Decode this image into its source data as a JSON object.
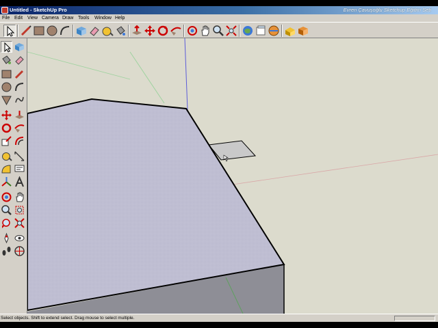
{
  "window": {
    "title": "Untitled - SketchUp Pro",
    "overlay_text": "Evren Çavuşoğlu Sketchup Eğitim Seti"
  },
  "menu": {
    "items": [
      "File",
      "Edit",
      "View",
      "Camera",
      "Draw",
      "Tools",
      "Window",
      "Help"
    ]
  },
  "toolbar": {
    "icons": [
      "select-icon",
      "pencil-line-icon",
      "rectangle-icon",
      "circle-icon",
      "arc-icon",
      "make-component-icon",
      "eraser-icon",
      "tape-measure-icon",
      "paint-bucket-icon",
      "push-pull-icon",
      "move-icon",
      "rotate-icon",
      "follow-me-icon",
      "orbit-icon",
      "pan-icon",
      "zoom-icon",
      "zoom-extents-icon",
      "get-models-icon",
      "share-model-icon",
      "google-earth-icon",
      "extension-warehouse-icon",
      "component-library-icon"
    ]
  },
  "left_toolbar": {
    "icons": [
      "select-icon",
      "make-component-icon",
      "paint-bucket-icon",
      "eraser-icon",
      "rectangle-icon",
      "line-icon",
      "circle-icon",
      "arc-icon",
      "polygon-icon",
      "freehand-icon",
      "move-icon",
      "push-pull-icon",
      "rotate-icon",
      "follow-me-icon",
      "scale-icon",
      "offset-icon",
      "tape-measure-icon",
      "dimension-icon",
      "protractor-icon",
      "text-icon",
      "axes-icon",
      "3d-text-icon",
      "orbit-icon",
      "pan-icon",
      "zoom-icon",
      "zoom-window-icon",
      "previous-view-icon",
      "zoom-extents-icon",
      "position-camera-icon",
      "look-around-icon",
      "walk-icon",
      "section-plane-icon"
    ]
  },
  "colors": {
    "chrome": "#d4d0c8",
    "viewport_background": "#dcdbcd",
    "top_face": "#c3c2d6",
    "side_face": "#8e8e96",
    "title_gradient_start": "#0a246a"
  },
  "status": {
    "text": "Select objects. Shift to extend select. Drag mouse to select multiple."
  }
}
